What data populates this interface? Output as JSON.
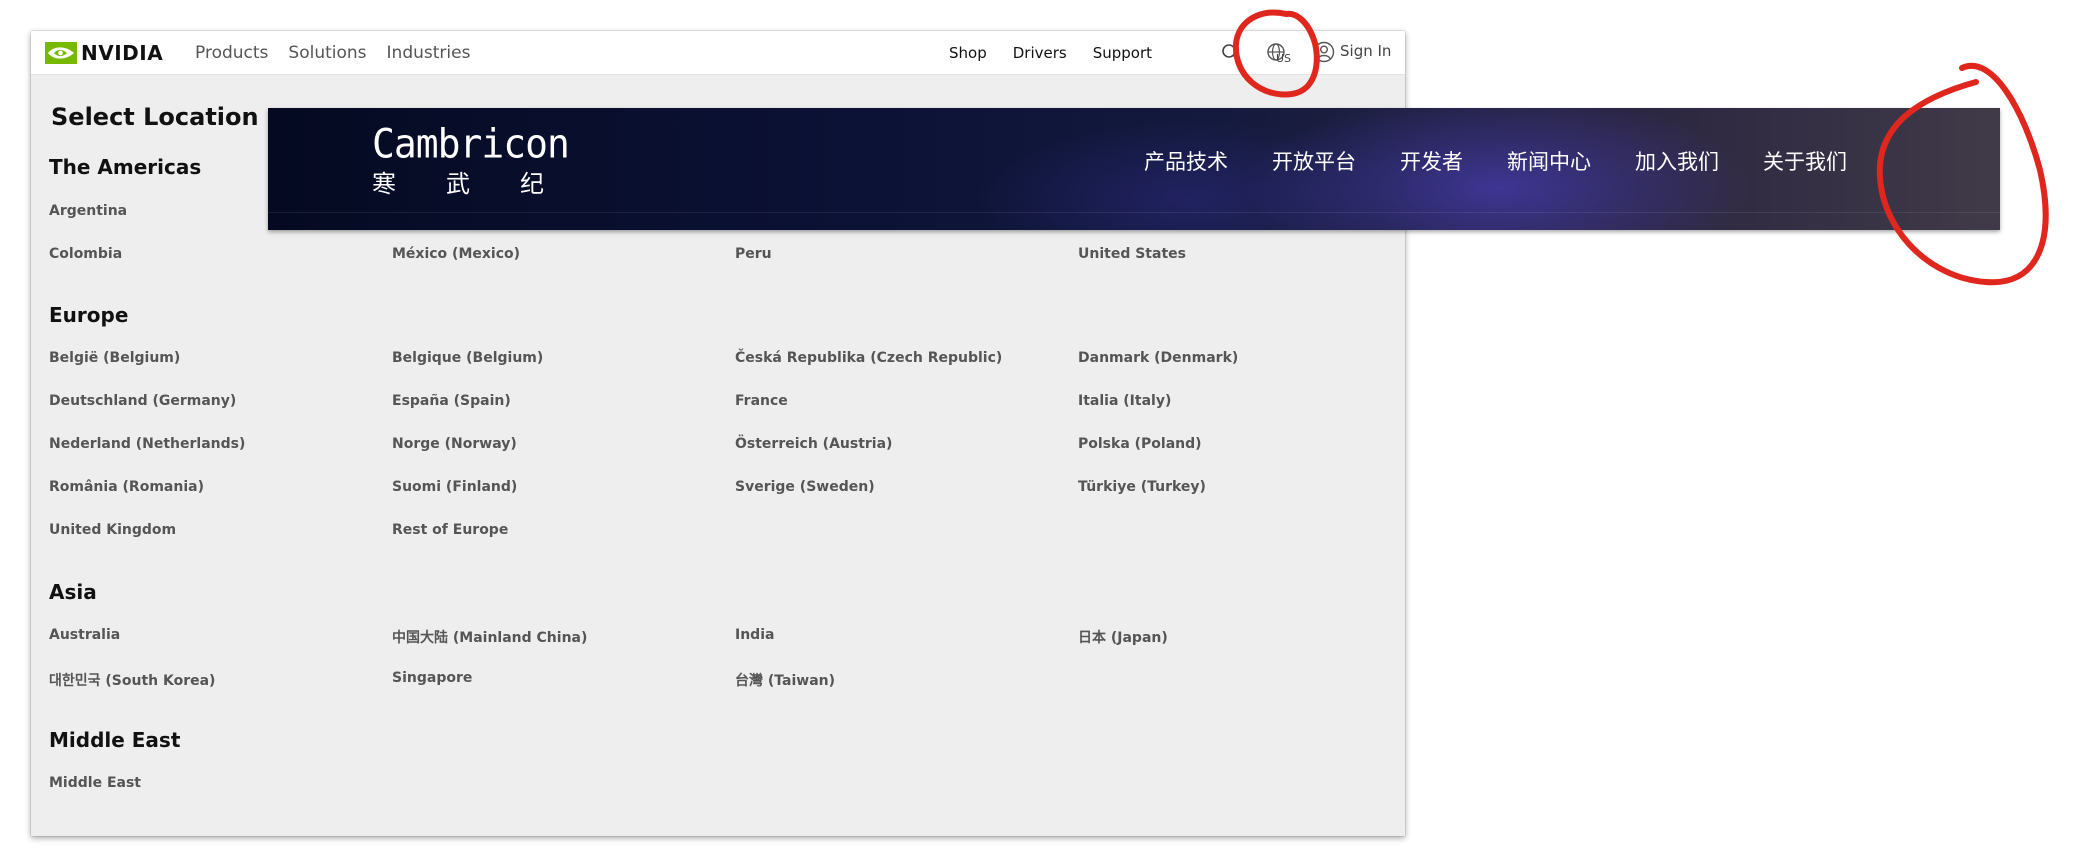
{
  "nvidia": {
    "logo_text": "NVIDIA",
    "nav_left": [
      "Products",
      "Solutions",
      "Industries"
    ],
    "nav_right": [
      "Shop",
      "Drivers",
      "Support"
    ],
    "locale_code": "US",
    "sign_in": "Sign In",
    "page_title": "Select Location",
    "accent": "#76b900"
  },
  "regions": [
    {
      "name": "The Americas",
      "rows": [
        [
          "Argentina",
          "",
          "",
          ""
        ],
        [
          "Colombia",
          "México (Mexico)",
          "Peru",
          "United States"
        ]
      ]
    },
    {
      "name": "Europe",
      "rows": [
        [
          "België (Belgium)",
          "Belgique (Belgium)",
          "Česká Republika (Czech Republic)",
          "Danmark (Denmark)"
        ],
        [
          "Deutschland (Germany)",
          "España (Spain)",
          "France",
          "Italia (Italy)"
        ],
        [
          "Nederland (Netherlands)",
          "Norge (Norway)",
          "Österreich (Austria)",
          "Polska (Poland)"
        ],
        [
          "România (Romania)",
          "Suomi (Finland)",
          "Sverige (Sweden)",
          "Türkiye (Turkey)"
        ],
        [
          "United Kingdom",
          "Rest of Europe",
          "",
          ""
        ]
      ]
    },
    {
      "name": "Asia",
      "rows": [
        [
          "Australia",
          "中国大陆 (Mainland China)",
          "India",
          "日本 (Japan)"
        ],
        [
          "대한민국 (South Korea)",
          "Singapore",
          "台灣 (Taiwan)",
          ""
        ]
      ]
    },
    {
      "name": "Middle East",
      "rows": [
        [
          "Middle East",
          "",
          "",
          ""
        ]
      ]
    }
  ],
  "cambricon": {
    "logo_en": "Cambricon",
    "logo_zh": [
      "寒",
      "武",
      "纪"
    ],
    "nav": [
      "产品技术",
      "开放平台",
      "开发者",
      "新闻中心",
      "加入我们",
      "关于我们"
    ]
  },
  "annotation_color": "#e0271e"
}
